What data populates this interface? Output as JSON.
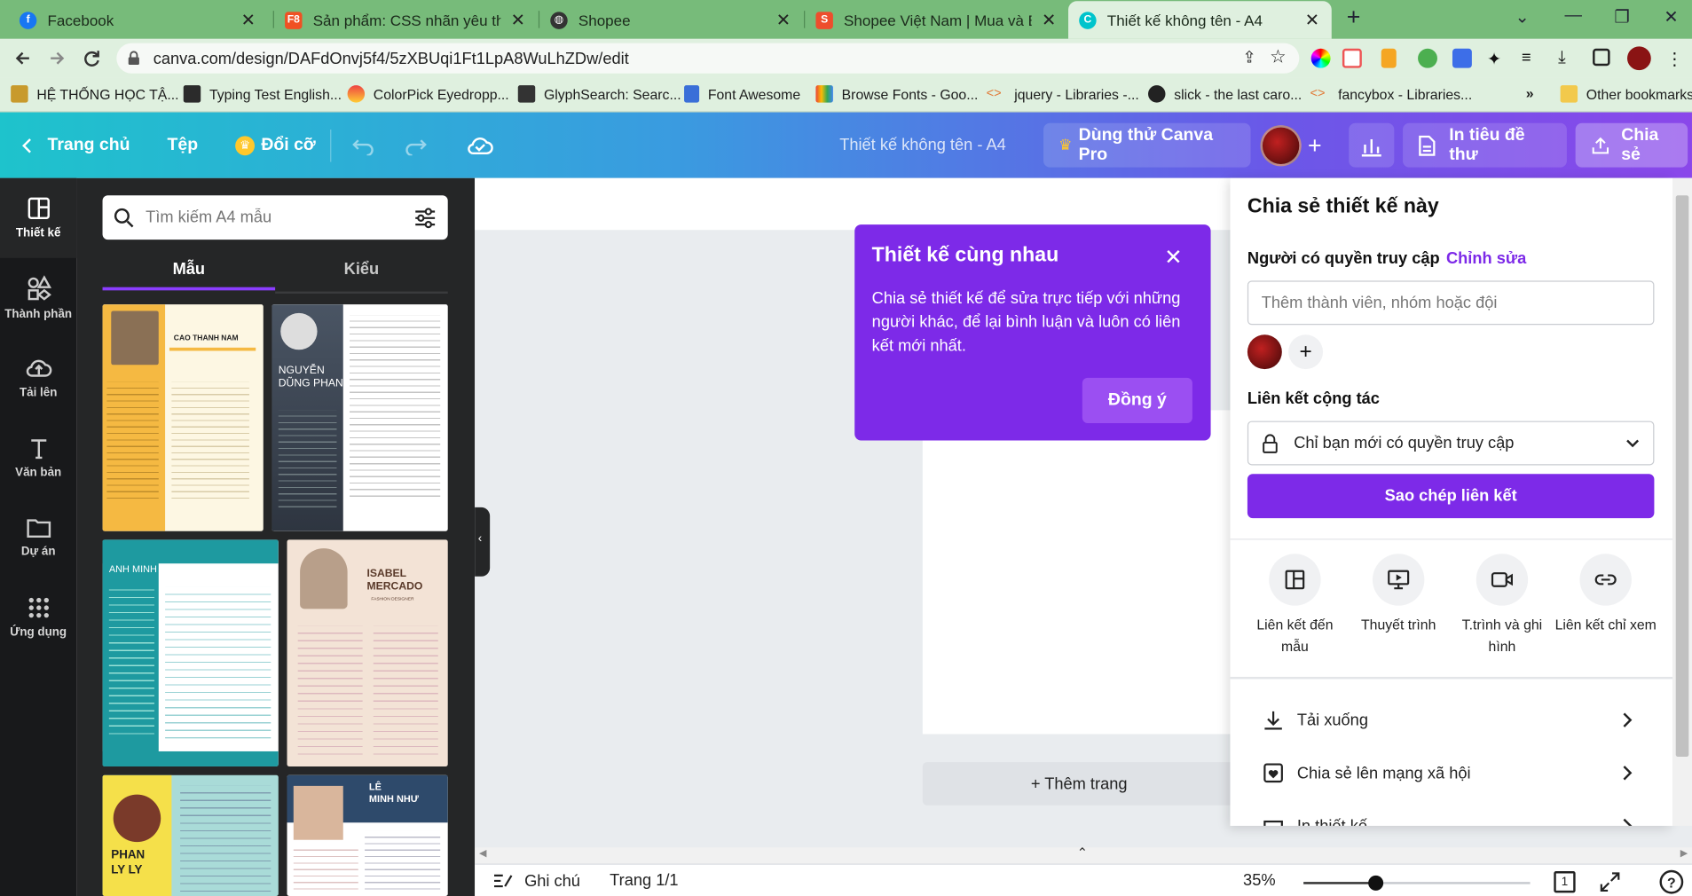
{
  "browser": {
    "tabs": [
      {
        "title": "Facebook",
        "favicon": "facebook-icon",
        "color": "#1877f2"
      },
      {
        "title": "Sản phẩm: CSS nhãn yêu thích",
        "favicon": "f8-icon",
        "color": "#f05123"
      },
      {
        "title": "Shopee",
        "favicon": "globe-icon",
        "color": "#333333"
      },
      {
        "title": "Shopee Việt Nam | Mua và Bán Tr",
        "favicon": "shopee-icon",
        "color": "#ee4d2d"
      },
      {
        "title": "Thiết kế không tên - A4",
        "favicon": "canva-icon",
        "color": "#00c4cc"
      }
    ],
    "url": "canva.com/design/DAFdOnvj5f4/5zXBUqi1Ft1LpA8WuLhZDw/edit",
    "bookmarks": [
      "HỆ THỐNG HỌC TẬ...",
      "Typing Test English...",
      "ColorPick Eyedropp...",
      "GlyphSearch: Searc...",
      "Font Awesome",
      "Browse Fonts - Goo...",
      "jquery - Libraries -...",
      "slick - the last caro...",
      "fancybox - Libraries..."
    ],
    "more_bookmarks": "»",
    "other_bookmarks": "Other bookmarks"
  },
  "header": {
    "home": "Trang chủ",
    "file": "Tệp",
    "resize": "Đổi cỡ",
    "doc_title": "Thiết kế không tên - A4",
    "try_pro": "Dùng thử Canva Pro",
    "print": "In tiêu đề thư",
    "share": "Chia sẻ"
  },
  "rail": [
    {
      "label": "Thiết kế",
      "icon": "layout-icon"
    },
    {
      "label": "Thành phần",
      "icon": "shapes-icon"
    },
    {
      "label": "Tải lên",
      "icon": "upload-icon"
    },
    {
      "label": "Văn bản",
      "icon": "text-icon"
    },
    {
      "label": "Dự án",
      "icon": "folder-icon"
    },
    {
      "label": "Ứng dụng",
      "icon": "apps-icon"
    }
  ],
  "panel": {
    "search_placeholder": "Tìm kiếm A4 mẫu",
    "tab_templates": "Mẫu",
    "tab_styles": "Kiểu",
    "templates": [
      {
        "name": "CAO THANH NAM",
        "bg": "#fdf7e3",
        "accent": "#f5b942"
      },
      {
        "name": "NGUYỄN DŨNG PHAN",
        "bg": "#ffffff",
        "accent": "#4a5564"
      },
      {
        "name": "ANH MINH",
        "bg": "#ffffff",
        "accent": "#1e9aa0"
      },
      {
        "name": "ISABEL MERCADO",
        "bg": "#f3e3d6",
        "accent": "#8a5a44"
      },
      {
        "name": "PHAN LY LY",
        "bg": "#a9dbd8",
        "accent": "#f5e04a"
      },
      {
        "name": "LÊ MINH NHƯ",
        "bg": "#ffffff",
        "accent": "#2e4a6b"
      }
    ],
    "template_labels": {
      "t1": "CAO THANH NAM",
      "t2a": "NGUYỄN",
      "t2b": "DŨNG PHAN",
      "t3": "ANH MINH",
      "t4a": "ISABEL",
      "t4b": "MERCADO",
      "t4c": "FASHION DESIGNER",
      "t5a": "PHAN",
      "t5b": "LY LY",
      "t6a": "LÊ",
      "t6b": "MINH NHƯ"
    }
  },
  "tooltip": {
    "title": "Thiết kế cùng nhau",
    "body": "Chia sẻ thiết kế để sửa trực tiếp với những người khác, để lại bình luận và luôn có liên kết mới nhất.",
    "ok": "Đồng ý"
  },
  "share": {
    "title": "Chia sẻ thiết kế này",
    "access_label": "Người có quyền truy cập",
    "edit": "Chỉnh sửa",
    "member_placeholder": "Thêm thành viên, nhóm hoặc đội",
    "collab_label": "Liên kết cộng tác",
    "access_value": "Chỉ bạn mới có quyền truy cập",
    "copy_link": "Sao chép liên kết",
    "options": [
      {
        "label": "Liên kết đến mẫu",
        "icon": "template-link-icon"
      },
      {
        "label": "Thuyết trình",
        "icon": "present-icon"
      },
      {
        "label": "T.trình và ghi hình",
        "icon": "record-icon"
      },
      {
        "label": "Liên kết chỉ xem",
        "icon": "view-link-icon"
      }
    ],
    "rows": [
      {
        "label": "Tải xuống",
        "icon": "download-icon"
      },
      {
        "label": "Chia sẻ lên mạng xã hội",
        "icon": "heart-icon"
      },
      {
        "label": "In thiết kế",
        "icon": "print-icon"
      }
    ]
  },
  "canvas": {
    "add_page": "+ Thêm trang"
  },
  "bottom": {
    "notes": "Ghi chú",
    "page": "Trang 1/1",
    "zoom": "35%",
    "page_count": "1",
    "zoom_level": 0.35
  }
}
